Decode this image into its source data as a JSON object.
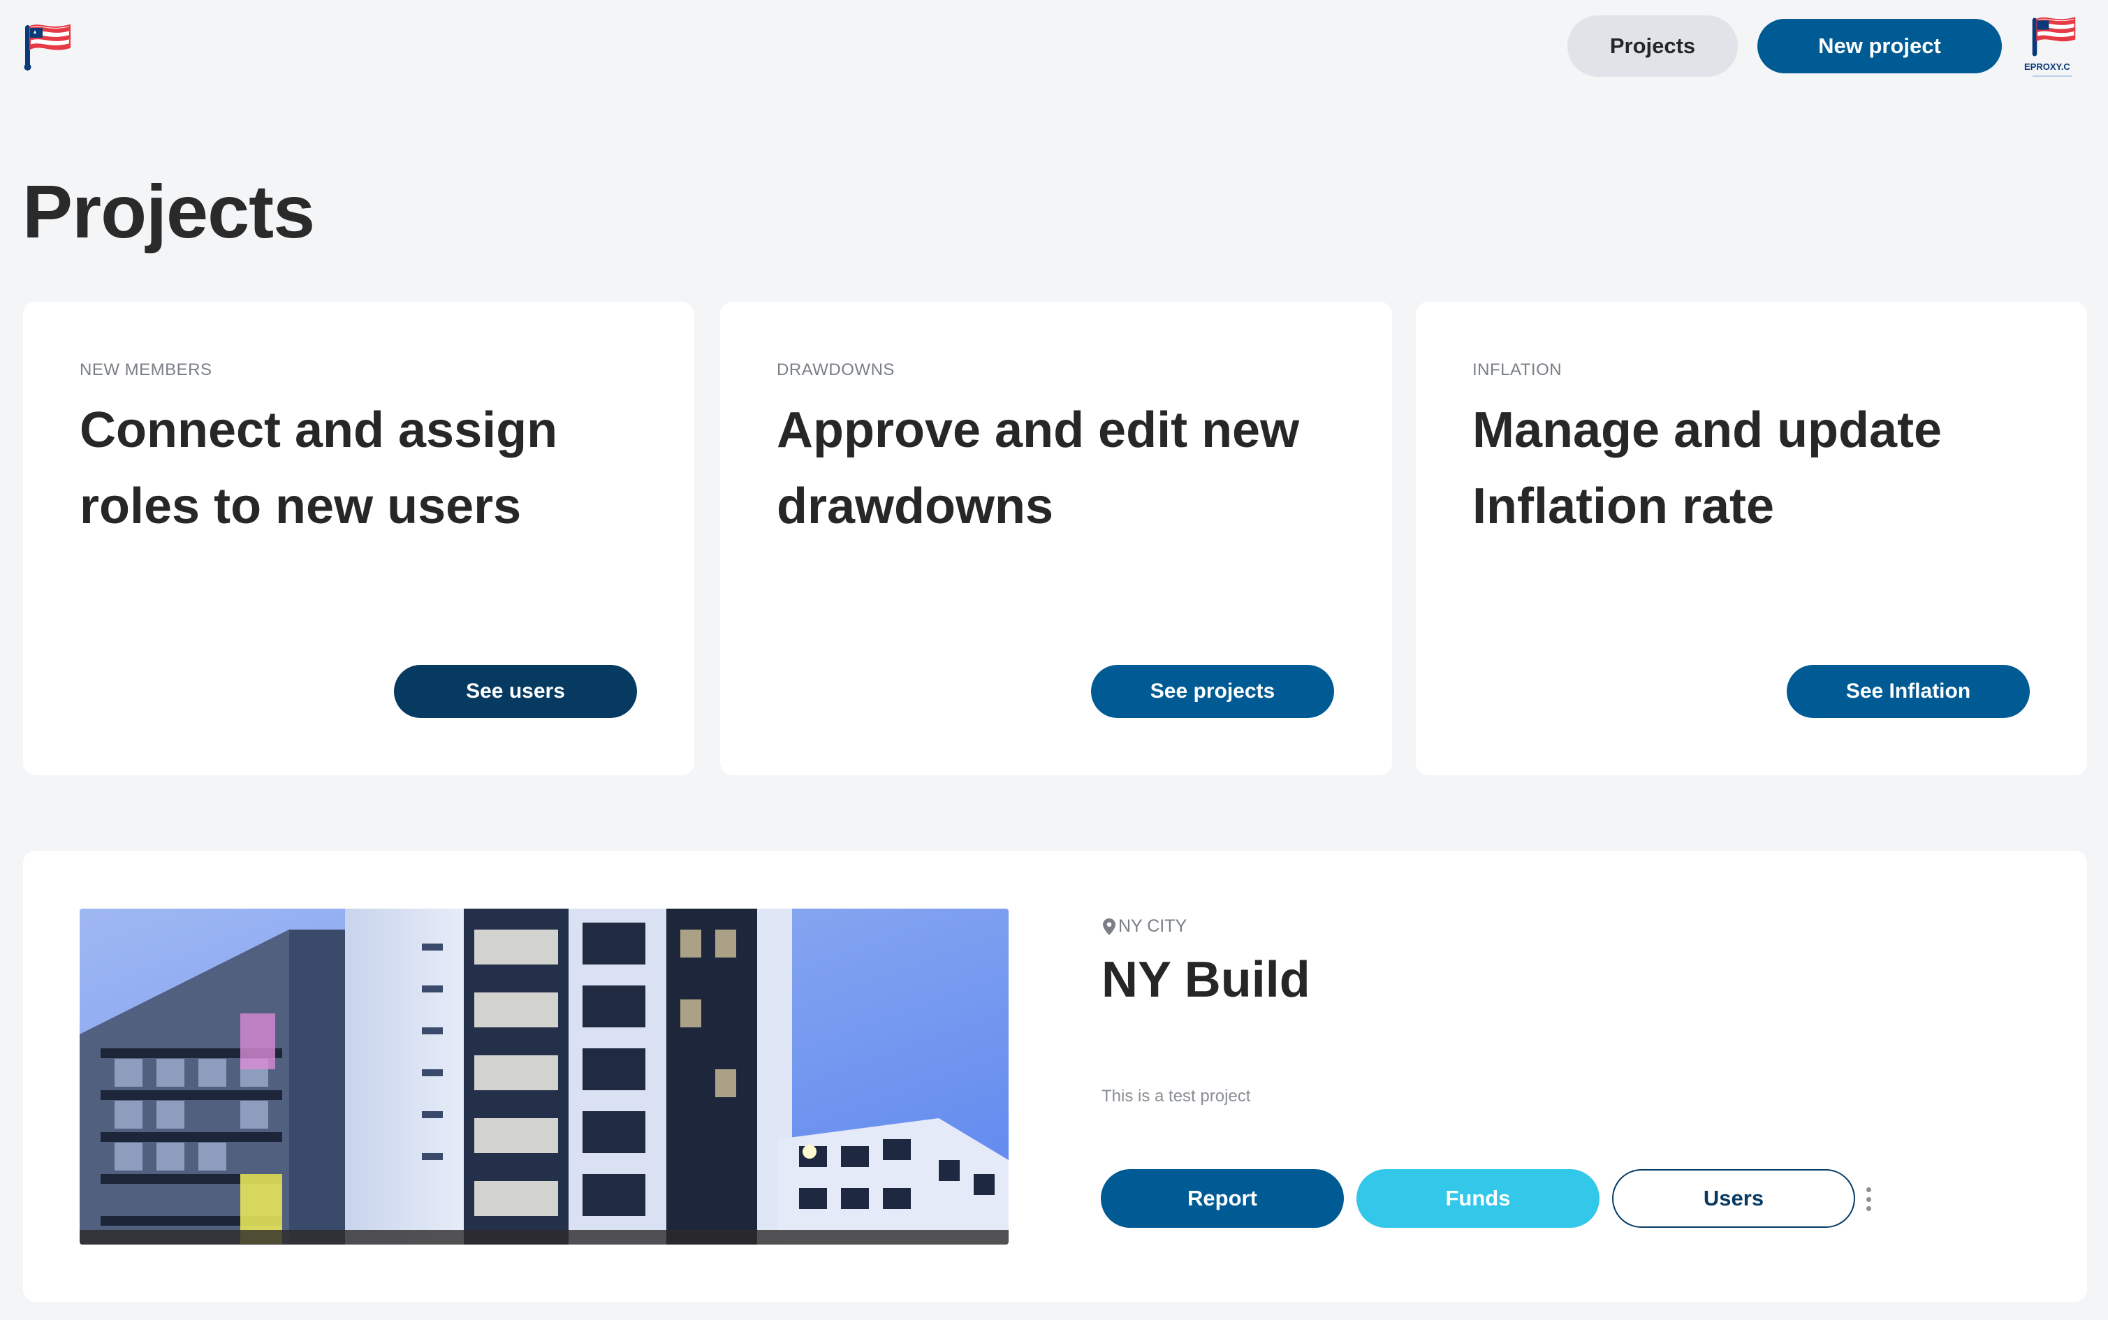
{
  "header": {
    "projects_label": "Projects",
    "new_project_label": "New project",
    "brand_text": "EPROXY.C"
  },
  "page": {
    "title": "Projects"
  },
  "cards": [
    {
      "eyebrow": "NEW MEMBERS",
      "headline": "Connect and assign roles to new users",
      "button": "See users"
    },
    {
      "eyebrow": "DRAWDOWNS",
      "headline": "Approve and edit new drawdowns",
      "button": "See projects"
    },
    {
      "eyebrow": "INFLATION",
      "headline": "Manage and update Inflation rate",
      "button": "See Inflation"
    }
  ],
  "project": {
    "location": "NY CITY",
    "name": "NY Build",
    "description": "This is a test project",
    "buttons": {
      "report": "Report",
      "funds": "Funds",
      "users": "Users"
    }
  },
  "colors": {
    "primary": "#005b94",
    "dark": "#063a61",
    "cyan": "#33c8ea",
    "flag_red": "#e53945"
  },
  "icons": {
    "logo": "flag-logo-icon",
    "location": "location-pin-icon",
    "more": "more-vertical-icon"
  }
}
